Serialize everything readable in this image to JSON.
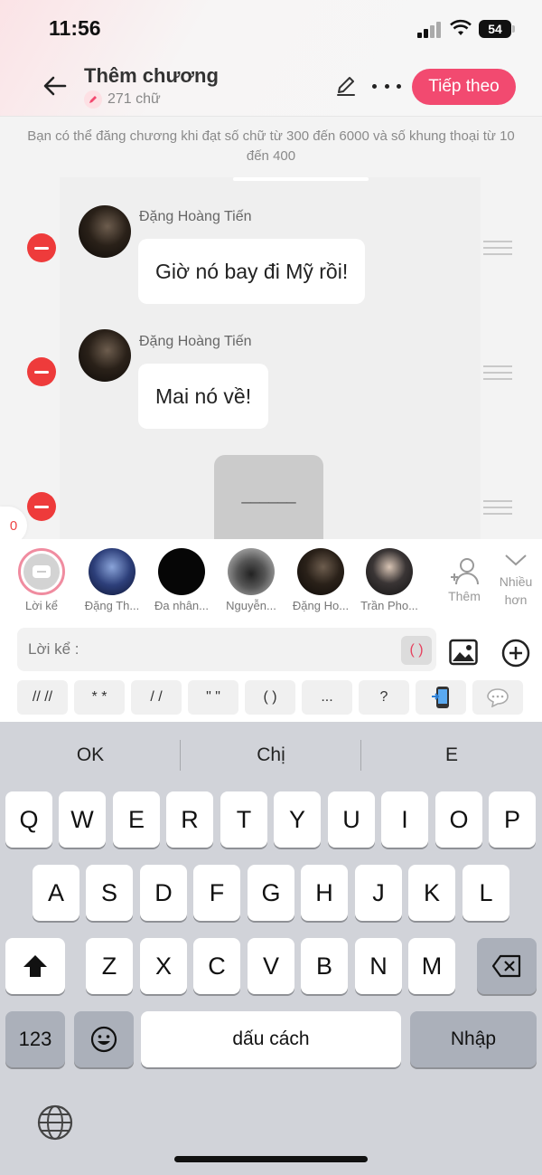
{
  "status_bar": {
    "time": "11:56",
    "battery": "54"
  },
  "header": {
    "title": "Thêm chương",
    "word_count": "271 chữ",
    "next_label": "Tiếp theo"
  },
  "notice": "Bạn có thể đăng chương khi đạt số chữ từ 300 đến 6000 và số khung thoại từ 10 đến 400",
  "messages": [
    {
      "sender": "Đặng Hoàng Tiến",
      "text": "Giờ nó bay đi Mỹ rồi!"
    },
    {
      "sender": "Đặng Hoàng Tiến",
      "text": "Mai nó về!"
    }
  ],
  "divider_text": "______",
  "side_badge": "0",
  "characters": [
    {
      "name": "Lời kể"
    },
    {
      "name": "Đặng Th..."
    },
    {
      "name": "Đa nhân..."
    },
    {
      "name": "Nguyễn..."
    },
    {
      "name": "Đặng Ho..."
    },
    {
      "name": "Trần Pho..."
    }
  ],
  "add_label": "Thêm",
  "more_label": "Nhiều\nhơn",
  "input": {
    "placeholder": "Lời kể :",
    "paren_chip": "( )"
  },
  "format_buttons": [
    "// //",
    "* *",
    "/ /",
    "\" \"",
    "( )",
    "...",
    "?"
  ],
  "keyboard": {
    "suggestions": [
      "OK",
      "Chị",
      "E"
    ],
    "row1": [
      "Q",
      "W",
      "E",
      "R",
      "T",
      "Y",
      "U",
      "I",
      "O",
      "P"
    ],
    "row2": [
      "A",
      "S",
      "D",
      "F",
      "G",
      "H",
      "J",
      "K",
      "L"
    ],
    "row3": [
      "Z",
      "X",
      "C",
      "V",
      "B",
      "N",
      "M"
    ],
    "numbers_label": "123",
    "space_label": "dấu cách",
    "return_label": "Nhập"
  },
  "colors": {
    "accent": "#f24a70",
    "remove": "#ee3b3b"
  }
}
